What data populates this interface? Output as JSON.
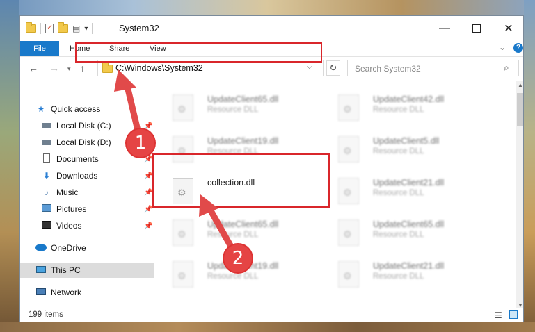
{
  "window": {
    "title": "System32",
    "min_glyph": "—",
    "close_glyph": "✕"
  },
  "ribbon": {
    "tabs": [
      "File",
      "Home",
      "Share",
      "View"
    ],
    "chevron_glyph": "⌄",
    "help_glyph": "?"
  },
  "nav": {
    "back_glyph": "←",
    "forward_glyph": "→",
    "recent_glyph": "▾",
    "up_glyph": "↑",
    "address": "C:\\Windows\\System32",
    "address_drop_glyph": "⌵",
    "refresh_glyph": "↻",
    "search_placeholder": "Search System32",
    "search_glyph": "⌕"
  },
  "sidebar": {
    "pin_glyph": "📌",
    "items": [
      {
        "label": "Quick access",
        "icon": "star-icon",
        "pinned": false
      },
      {
        "label": "Local Disk (C:)",
        "icon": "disk-icon",
        "pinned": true
      },
      {
        "label": "Local Disk (D:)",
        "icon": "disk-icon",
        "pinned": true
      },
      {
        "label": "Documents",
        "icon": "documents-icon",
        "pinned": true
      },
      {
        "label": "Downloads",
        "icon": "downloads-icon",
        "pinned": true
      },
      {
        "label": "Music",
        "icon": "music-icon",
        "pinned": true
      },
      {
        "label": "Pictures",
        "icon": "pictures-icon",
        "pinned": true
      },
      {
        "label": "Videos",
        "icon": "videos-icon",
        "pinned": true
      },
      {
        "label": "OneDrive",
        "icon": "cloud-icon",
        "pinned": false
      },
      {
        "label": "This PC",
        "icon": "pc-icon",
        "pinned": false,
        "selected": true
      },
      {
        "label": "Network",
        "icon": "network-icon",
        "pinned": false
      }
    ]
  },
  "files": [
    {
      "name": "UpdateClient65.dll",
      "type": "Resource DLL",
      "blurred": true
    },
    {
      "name": "UpdateClient42.dll",
      "type": "Resource DLL",
      "blurred": true
    },
    {
      "name": "UpdateClient19.dll",
      "type": "Resource DLL",
      "blurred": true
    },
    {
      "name": "UpdateClient5.dll",
      "type": "Resource DLL",
      "blurred": true
    },
    {
      "name": "collection.dll",
      "type": "",
      "blurred": false
    },
    {
      "name": "UpdateClient21.dll",
      "type": "Resource DLL",
      "blurred": true
    },
    {
      "name": "UpdateClient65.dll",
      "type": "Resource DLL",
      "blurred": true
    },
    {
      "name": "UpdateClient65.dll",
      "type": "Resource DLL",
      "blurred": true
    },
    {
      "name": "UpdateClient19.dll",
      "type": "Resource DLL",
      "blurred": true
    },
    {
      "name": "UpdateClient21.dll",
      "type": "Resource DLL",
      "blurred": true
    }
  ],
  "status": {
    "count": "199 items",
    "details_glyph": "☰"
  },
  "annotations": {
    "step1": "1",
    "step2": "2",
    "color": "#e14a4a"
  },
  "scroll": {
    "up_glyph": "▲",
    "down_glyph": "▼"
  }
}
